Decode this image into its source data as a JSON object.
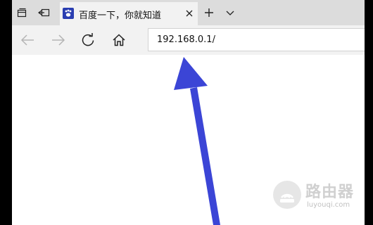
{
  "tab": {
    "title": "百度一下，你就知道"
  },
  "address_bar": {
    "url": "192.168.0.1/"
  },
  "icons": {
    "tab_manager": "tabs-icon",
    "set_aside": "set-aside-icon",
    "favicon": "baidu-paw-icon",
    "close": "close-icon",
    "new_tab": "plus-icon",
    "tab_dropdown": "chevron-down-icon",
    "back": "arrow-left-icon",
    "forward": "arrow-right-icon",
    "refresh": "refresh-icon",
    "home": "home-icon"
  },
  "annotation": {
    "color": "#3b45d6"
  },
  "watermark": {
    "title": "路由器",
    "subtitle": "luyouqi.com"
  }
}
